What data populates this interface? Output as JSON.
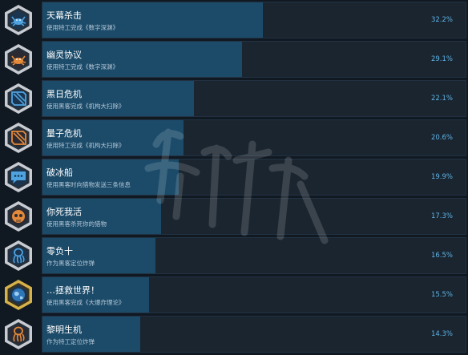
{
  "colors": {
    "background": "#101822",
    "panel": "#1a2530",
    "fill": "#1c4b6a",
    "percent_text": "#5fb3e4",
    "icon_frame_silver": "#c8ccd2",
    "icon_frame_gold": "#d6b24a"
  },
  "achievements": [
    {
      "title": "天幕杀击",
      "description": "使用特工完成《数字深渊》",
      "percent": "32.2%",
      "unlock_fraction": 0.322,
      "icon": "crab-icon",
      "frame": "silver"
    },
    {
      "title": "幽灵协议",
      "description": "使用特工完成《数字深渊》",
      "percent": "29.1%",
      "unlock_fraction": 0.291,
      "icon": "crab-orange-icon",
      "frame": "silver"
    },
    {
      "title": "黑日危机",
      "description": "使用黑客完成《机构大扫除》",
      "percent": "22.1%",
      "unlock_fraction": 0.221,
      "icon": "folded-flag-icon",
      "frame": "silver"
    },
    {
      "title": "量子危机",
      "description": "使用特工完成《机构大扫除》",
      "percent": "20.6%",
      "unlock_fraction": 0.206,
      "icon": "folded-flag-orange-icon",
      "frame": "silver"
    },
    {
      "title": "破冰船",
      "description": "使用黑客时向猎物发送三条信息",
      "percent": "19.9%",
      "unlock_fraction": 0.199,
      "icon": "chat-bubble-icon",
      "frame": "silver"
    },
    {
      "title": "你死我活",
      "description": "使用黑客杀死你的猎物",
      "percent": "17.3%",
      "unlock_fraction": 0.173,
      "icon": "skull-icon",
      "frame": "silver"
    },
    {
      "title": "零负十",
      "description": "作为黑客定位炸弹",
      "percent": "16.5%",
      "unlock_fraction": 0.165,
      "icon": "octopus-icon",
      "frame": "silver"
    },
    {
      "title": "…拯救世界！",
      "description": "使用黑客完成《大爆炸理论》",
      "percent": "15.5%",
      "unlock_fraction": 0.155,
      "icon": "globe-icon",
      "frame": "gold"
    },
    {
      "title": "黎明生机",
      "description": "作为特工定位炸弹",
      "percent": "14.3%",
      "unlock_fraction": 0.143,
      "icon": "octopus-orange-icon",
      "frame": "silver"
    }
  ]
}
